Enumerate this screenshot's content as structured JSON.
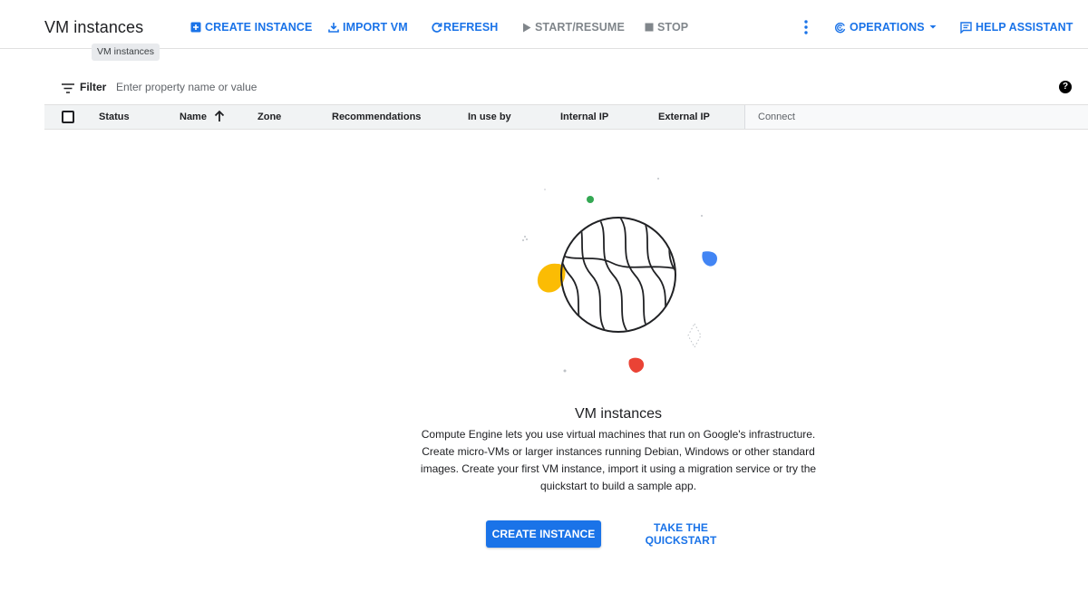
{
  "header": {
    "title": "VM instances",
    "tooltip": "VM instances",
    "actions": {
      "create_instance": "CREATE INSTANCE",
      "import_vm": "IMPORT VM",
      "refresh": "REFRESH",
      "start_resume": "START/RESUME",
      "stop": "STOP",
      "operations": "OPERATIONS",
      "help_assistant": "HELP ASSISTANT"
    }
  },
  "filter": {
    "label": "Filter",
    "placeholder": "Enter property name or value",
    "value": ""
  },
  "table": {
    "columns": {
      "status": "Status",
      "name": "Name",
      "zone": "Zone",
      "recommendations": "Recommendations",
      "in_use_by": "In use by",
      "internal_ip": "Internal IP",
      "external_ip": "External IP",
      "connect": "Connect"
    }
  },
  "empty_state": {
    "title": "VM instances",
    "description": "Compute Engine lets you use virtual machines that run on Google's infrastructure. Create micro-VMs or larger instances running Debian, Windows or other standard images. Create your first VM instance, import it using a migration service or try the quickstart to build a sample app.",
    "primary_button": "CREATE INSTANCE",
    "secondary_button": "TAKE THE QUICKSTART"
  },
  "colors": {
    "accent": "#1a73e8",
    "google_yellow": "#fbbc04",
    "google_blue": "#4285f4",
    "google_red": "#ea4335",
    "google_green": "#34a853"
  }
}
